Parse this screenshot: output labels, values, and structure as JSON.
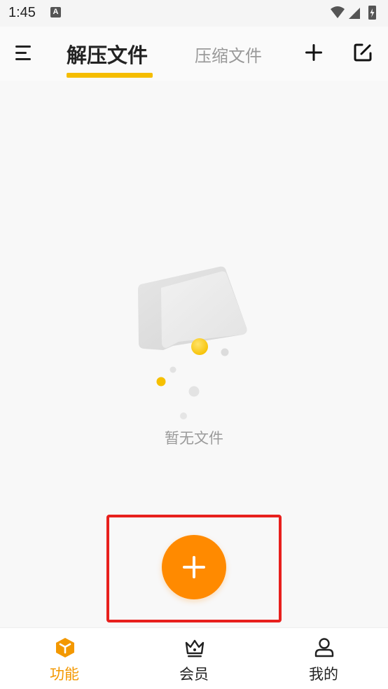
{
  "status_bar": {
    "time": "1:45",
    "notification_icon": "a-icon"
  },
  "header": {
    "menu_icon": "menu-icon",
    "tabs": [
      {
        "label": "解压文件",
        "active": true
      },
      {
        "label": "压缩文件",
        "active": false
      }
    ],
    "add_icon": "plus-icon",
    "edit_icon": "edit-icon",
    "accent_color": "#f5bd00"
  },
  "content": {
    "empty_text": "暂无文件",
    "fab_icon": "plus-icon",
    "fab_color": "#ff8a00"
  },
  "bottom_nav": {
    "items": [
      {
        "label": "功能",
        "icon": "function-cube-icon",
        "active": true
      },
      {
        "label": "会员",
        "icon": "crown-icon",
        "active": false
      },
      {
        "label": "我的",
        "icon": "user-icon",
        "active": false
      }
    ],
    "active_color": "#f39800"
  }
}
